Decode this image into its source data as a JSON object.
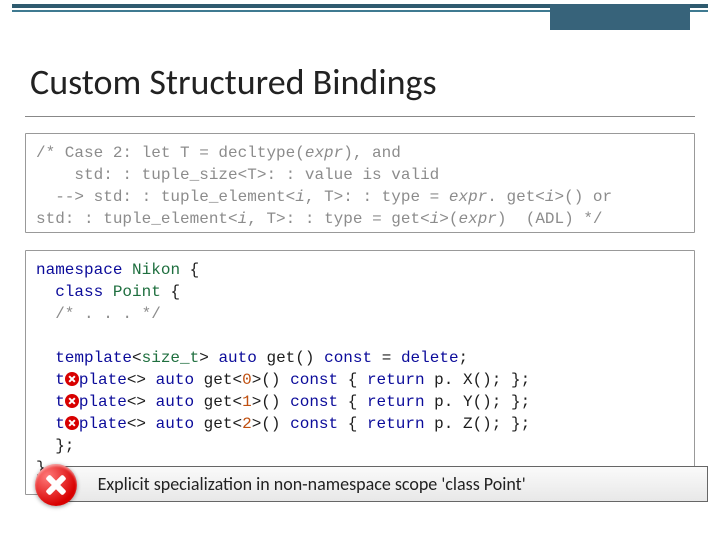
{
  "title": "Custom Structured Bindings",
  "comment": {
    "l1a": "/* Case 2: let T = decltype(",
    "l1b": "expr",
    "l1c": "), and",
    "l2": "    std: : tuple_size<T>: : value is valid",
    "l3a": "  --> std: : tuple_element<",
    "l3b": "i",
    "l3c": ", T>: : type = ",
    "l3d": "expr",
    "l3e": ". get<",
    "l3f": "i",
    "l3g": ">() or",
    "l4a": "std: : tuple_element<",
    "l4b": "i",
    "l4c": ", T>: : type = get<",
    "l4d": "i",
    "l4e": ">(",
    "l4f": "expr",
    "l4g": ")  (ADL) */"
  },
  "code": {
    "kw_namespace": "namespace",
    "ns": "Nikon",
    "lbrace": "{",
    "kw_class": "class",
    "cls": "Point",
    "class_open": "{",
    "ellipsis": "/* . . . */",
    "kw_template": "template",
    "kw_auto": "auto",
    "kw_const": "const",
    "kw_delete": "delete",
    "kw_return": "return",
    "size_t": "size_t",
    "lt": "<",
    "gt": ">",
    "get": "get",
    "eq": "=",
    "semi": ";",
    "empty_spec": "<>",
    "n0": "0",
    "n1": "1",
    "n2": "2",
    "px": "p. X();",
    "py": "p. Y();",
    "pz": "p. Z();",
    "class_close": "};",
    "ns_close": "}"
  },
  "error": {
    "text": "Explicit specialization in non-namespace scope 'class Point'"
  }
}
